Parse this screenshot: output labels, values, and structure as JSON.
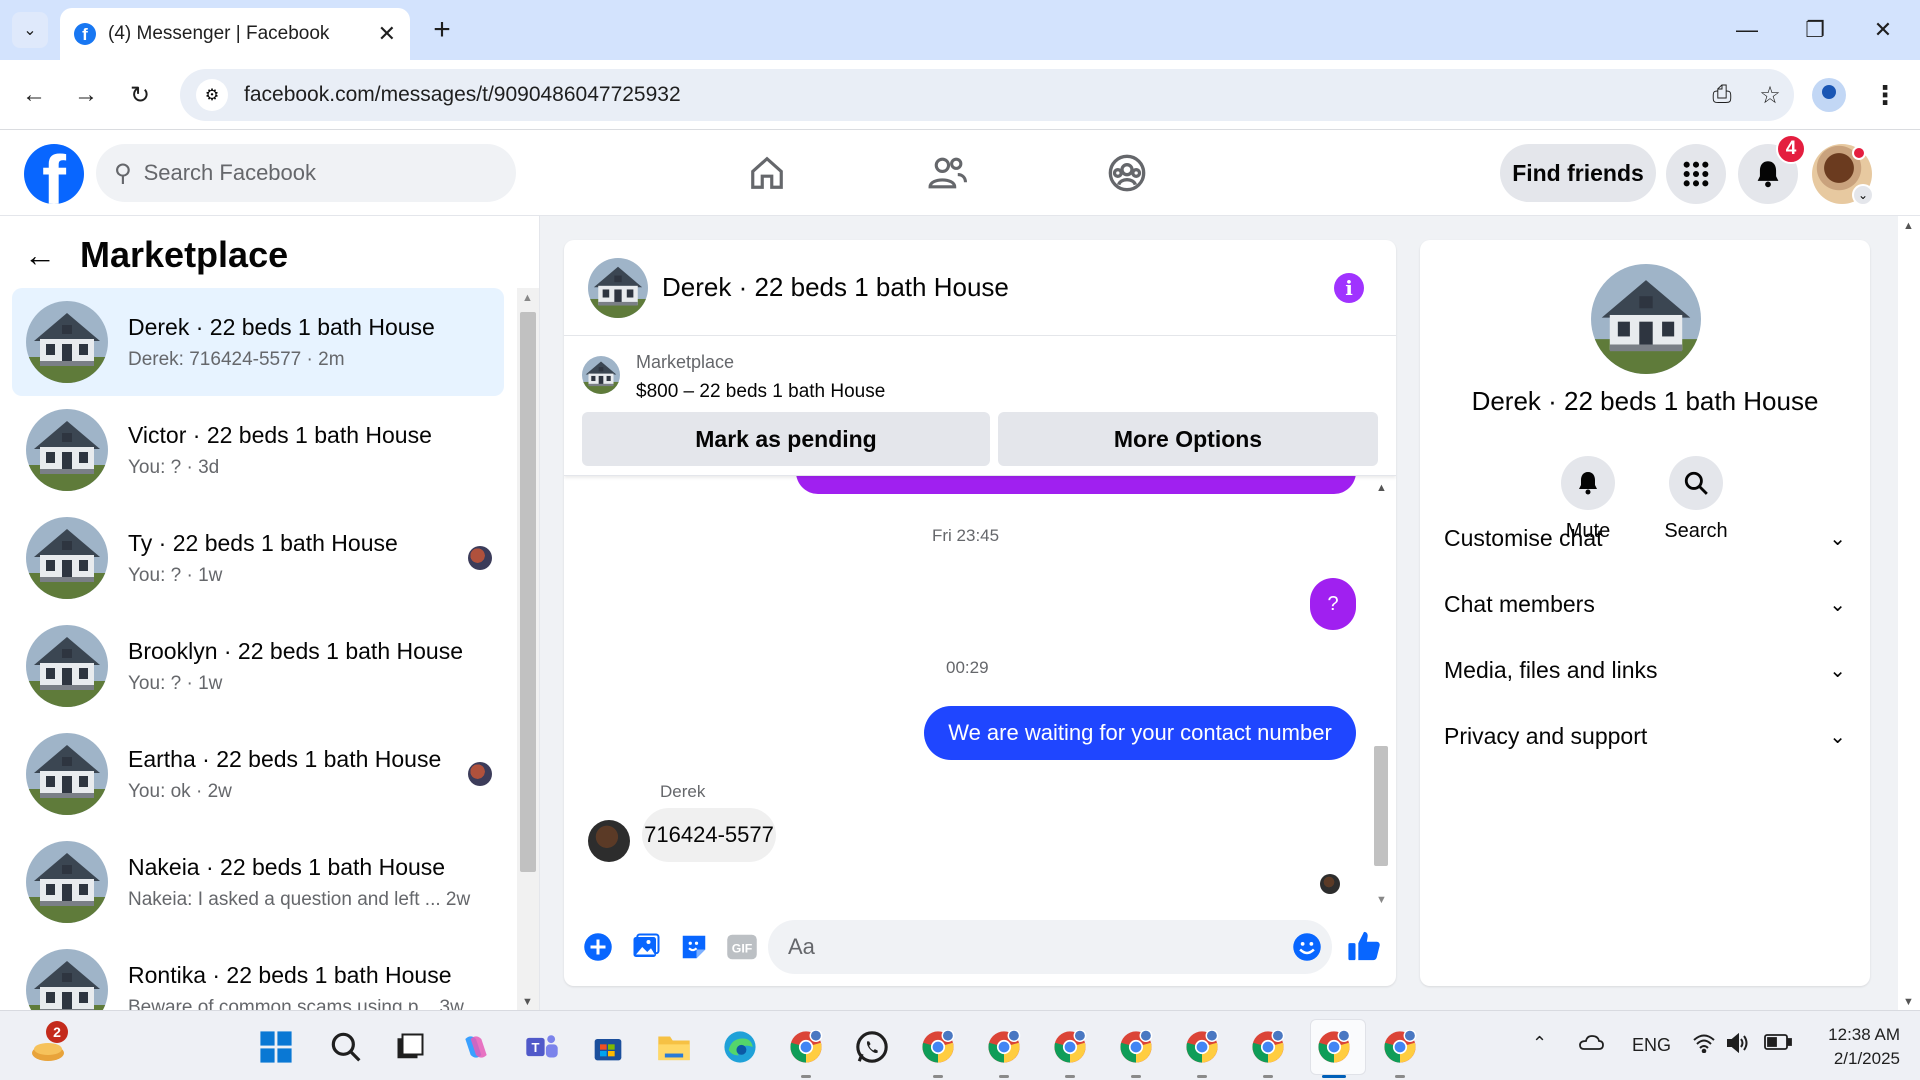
{
  "browser": {
    "tab_title": "(4) Messenger | Facebook",
    "url": "facebook.com/messages/t/9090486047725932",
    "icons": [
      "tab-search-icon",
      "close-icon",
      "new-tab-icon",
      "minimize-icon",
      "restore-icon",
      "window-close-icon",
      "back-icon",
      "forward-icon",
      "reload-icon",
      "site-info-icon",
      "install-app-icon",
      "bookmark-star-icon",
      "profile-icon",
      "menu-icon"
    ]
  },
  "fb_nav": {
    "search_placeholder": "Search Facebook",
    "find_friends": "Find friends",
    "notification_count": "4",
    "icons": [
      "facebook-logo",
      "search-icon",
      "home-icon",
      "friends-icon",
      "groups-icon",
      "menu-grid-icon",
      "bell-icon"
    ]
  },
  "left": {
    "title": "Marketplace",
    "conversations": [
      {
        "name": "Derek · 22 beds 1 bath House",
        "preview": "Derek: 716424-5577 · 2m",
        "active": true
      },
      {
        "name": "Victor · 22 beds 1 bath House",
        "preview": "You: ? · 3d"
      },
      {
        "name": "Ty · 22 beds 1 bath House",
        "preview": "You: ? · 1w",
        "seen": true
      },
      {
        "name": "Brooklyn · 22 beds 1 bath House",
        "preview": "You: ? · 1w"
      },
      {
        "name": "Eartha · 22 beds 1 bath House",
        "preview": "You: ok · 2w",
        "seen": true
      },
      {
        "name": "Nakeia · 22 beds 1 bath House",
        "preview": "Nakeia: I asked a question and left ...  2w"
      },
      {
        "name": "Rontika · 22 beds 1 bath House",
        "preview": "Beware of common scams using p...  3w"
      }
    ]
  },
  "chat": {
    "title": "Derek · 22 beds 1 bath House",
    "marketplace_label": "Marketplace",
    "listing": "$800 – 22 beds 1 bath House",
    "mark_pending": "Mark as pending",
    "more_options": "More Options",
    "timestamp1": "Fri 23:45",
    "msg_q": "?",
    "timestamp2": "00:29",
    "msg_out": "We are waiting for your contact number",
    "sender": "Derek",
    "msg_in": "716424-5577",
    "input_placeholder": "Aa",
    "colors": {
      "accent": "#a020f0",
      "outgoing": "#1f46ff",
      "fb_blue": "#0866ff"
    }
  },
  "info": {
    "name": "Derek · 22 beds 1 bath House",
    "mute": "Mute",
    "search": "Search",
    "sections": [
      "Customise chat",
      "Chat members",
      "Media, files and links",
      "Privacy and support"
    ]
  },
  "taskbar": {
    "badge": "2",
    "lang": "ENG",
    "time": "12:38 AM",
    "date": "2/1/2025"
  }
}
